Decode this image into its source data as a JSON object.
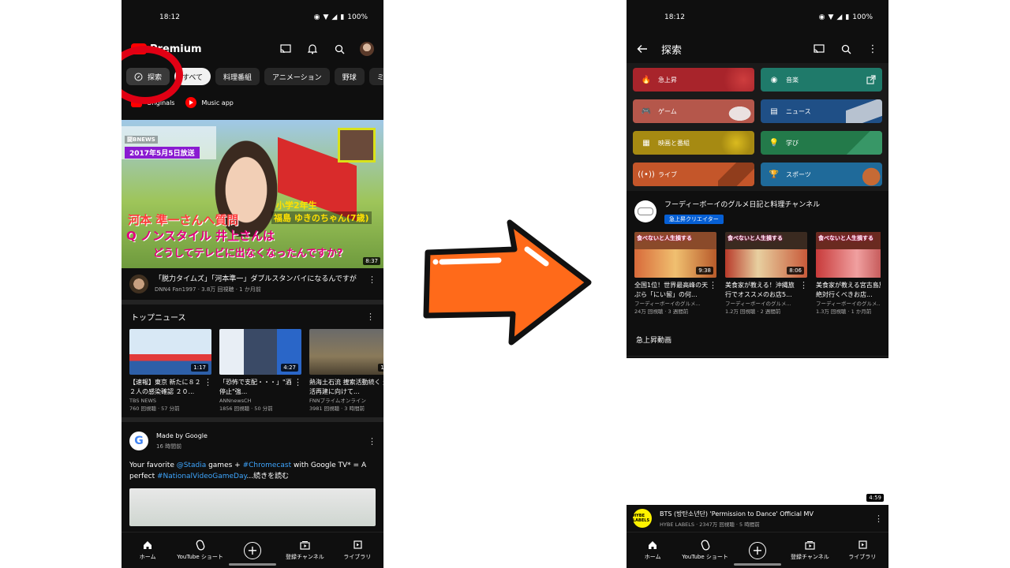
{
  "left": {
    "status": {
      "time": "18:12",
      "battery": "100%"
    },
    "header": {
      "logo": "Premium"
    },
    "chips": {
      "explore": "探索",
      "all": "すべて",
      "cooking": "料理番組",
      "anime": "アニメーション",
      "baseball": "野球",
      "more": "ミッ"
    },
    "sublinks": {
      "originals": "Originals",
      "music": "Music app"
    },
    "main_video": {
      "overlay_date": "2017年5月5日放送",
      "overlay_tag": "闘BNEWS",
      "overlay_grade": "小学2年生",
      "overlay_name": "福島 ゆきのちゃん(7歳)",
      "overlay_caption1": "河本 準一さんへ質問",
      "overlay_caption2": "Q ノンスタイル 井上さんは",
      "overlay_caption3": "どうしてテレビに出なくなったんですか?",
      "duration": "8:37",
      "title": "「脱力タイムズ」「河本準一」ダブルスタンバイになるんですが",
      "sub": "DNN4 Fan1997 · 3.8万 回視聴 · 1 か月前"
    },
    "top_news": {
      "heading": "トップニュース",
      "items": [
        {
          "title": "【速報】東京 新たに８２２人の感染確認 ２０...",
          "channel": "TBS NEWS",
          "meta": "760 回視聴 · 57 分前",
          "duration": "1:17"
        },
        {
          "title": "「恐怖で支配・・・」\"酒停止\"強...",
          "channel": "ANNnewsCH",
          "meta": "1856 回視聴 · 50 分前",
          "duration": "4:27"
        },
        {
          "title": "熱海土石流 捜索活動続く 生活再建に向けて...",
          "channel": "FNNプライムオンライン",
          "meta": "3981 回視聴 · 3 時間前",
          "duration": "1:"
        }
      ]
    },
    "post": {
      "author": "Made by Google",
      "time": "16 時間前",
      "text1": "Your favorite ",
      "link1": "@Stadia",
      "text2": " games + ",
      "link2": "#Chromecast",
      "text3": " with Google TV* = A perfect ",
      "link3": "#NationalVideoGameDay",
      "text4": "...続きを読む"
    }
  },
  "nav": {
    "home": "ホーム",
    "shorts": "YouTube ショート",
    "subs": "登録チャンネル",
    "library": "ライブラリ"
  },
  "right": {
    "status": {
      "time": "18:12",
      "battery": "100%"
    },
    "header": {
      "title": "探索"
    },
    "categories": [
      {
        "label": "急上昇",
        "color": "#a8242b"
      },
      {
        "label": "音楽",
        "color": "#1f7a6a"
      },
      {
        "label": "ゲーム",
        "color": "#b5574b"
      },
      {
        "label": "ニュース",
        "color": "#1f4f86"
      },
      {
        "label": "映画と番組",
        "color": "#a68a12"
      },
      {
        "label": "学び",
        "color": "#237a4a"
      },
      {
        "label": "ライブ",
        "color": "#c4562a"
      },
      {
        "label": "スポーツ",
        "color": "#1f6a9a"
      }
    ],
    "creator": {
      "name": "フーディーボーイのグルメ日記と料理チャンネル",
      "badge": "急上昇クリエイター",
      "videos": [
        {
          "caption": "食べないと人生損する",
          "duration": "9:38",
          "title": "全国1位！世界最高峰の天ぷら「にい留」の何...",
          "channel": "フーディーボーイのグルメ...",
          "meta": "24万 回視聴 · 3 週間前"
        },
        {
          "caption": "食べないと人生損する",
          "duration": "8:06",
          "title": "美食家が教える！沖縄旅行でオススメのお店5...",
          "channel": "フーディーボーイのグルメ...",
          "meta": "1.2万 回視聴 · 2 週間前"
        },
        {
          "caption": "食べないと人生損する",
          "duration": "9:",
          "title": "美食家が教える宮古島旅行で絶対行くべきお店...",
          "channel": "フーディーボーイのグルメ...",
          "meta": "1.3万 回視聴 · 1 か月前"
        }
      ]
    },
    "trending_label": "急上昇動画",
    "mini": {
      "duration": "4:59",
      "avatar": "HYBE LABELS",
      "title": "BTS (방탄소년단) 'Permission to Dance' Official MV",
      "sub": "HYBE LABELS · 2347万 回視聴 · 5 時間前"
    }
  },
  "colors": {
    "brand_red": "#ff0000",
    "arrow_orange": "#ff6a1a",
    "highlight_red": "#e10014",
    "link_blue": "#3ea6ff"
  }
}
